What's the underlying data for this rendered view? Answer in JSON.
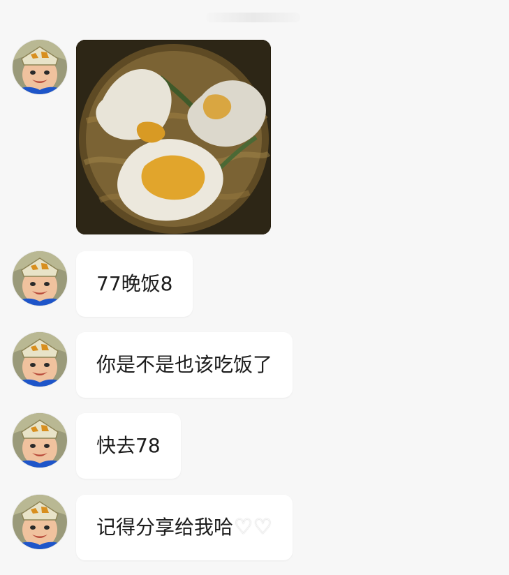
{
  "chat": {
    "messages": [
      {
        "type": "image",
        "image_alt": "instant noodles with fried eggs"
      },
      {
        "type": "text",
        "text": "77晚饭8"
      },
      {
        "type": "text",
        "text": "你是不是也该吃饭了"
      },
      {
        "type": "text",
        "text": "快去78"
      },
      {
        "type": "text",
        "text": "记得分享给我哈",
        "emoji_icons": [
          "white-heart-icon",
          "white-heart-icon"
        ]
      }
    ]
  },
  "colors": {
    "background": "#f7f7f7",
    "bubble": "#ffffff",
    "text": "#1c1c1c"
  }
}
